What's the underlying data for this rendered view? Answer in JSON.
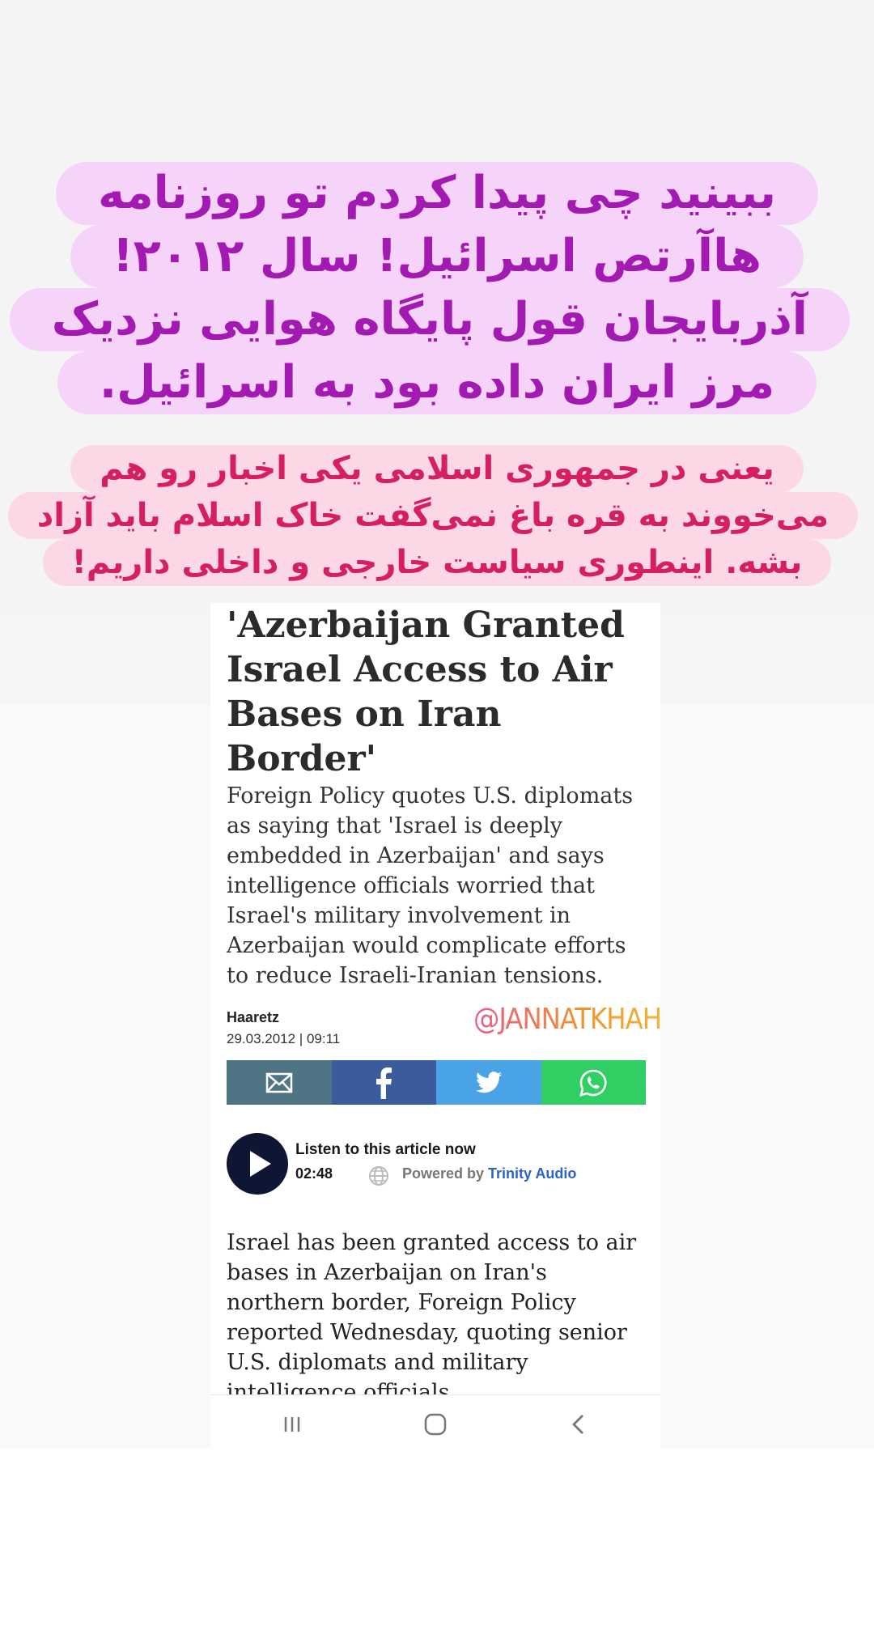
{
  "overlay": {
    "purple_lines": [
      "ببینید چی پیدا کردم تو روزنامه",
      "هاآرتص اسرائیل! سال ۲۰۱۲!",
      "آذربایجان قول پایگاه هوایی نزدیک",
      "مرز ایران داده بود به اسرائیل."
    ],
    "pink_lines": [
      "یعنی در جمهوری اسلامی یکی اخبار رو هم",
      "می‌خووند به قره باغ نمی‌گفت خاک اسلام باید آزاد",
      "بشه. اینطوری سیاست خارجی و داخلی داریم!"
    ],
    "purple_color": "#a31ab3",
    "pink_color": "#d61f63"
  },
  "article": {
    "headline": "'Azerbaijan Granted Israel Access to Air Bases on Iran Border'",
    "summary": "Foreign Policy quotes U.S. diplomats as saying that 'Israel is deeply embedded in Azerbaijan' and says intelligence officials worried that Israel's military involvement in Azerbaijan would complicate efforts to reduce Israeli-Iranian tensions.",
    "source": "Haaretz",
    "date": "29.03.2012 | 09:11",
    "watermark": "@JANNATKHAH.IR",
    "share": [
      {
        "name": "email-icon",
        "color": "#4f7584"
      },
      {
        "name": "facebook-icon",
        "color": "#3a5c9c"
      },
      {
        "name": "twitter-icon",
        "color": "#4aa3e6"
      },
      {
        "name": "whatsapp-icon",
        "color": "#2fcf63"
      }
    ],
    "audio": {
      "title": "Listen to this article now",
      "duration": "02:48",
      "powered_by": "Powered by",
      "provider": "Trinity Audio"
    },
    "body": "Israel has been granted access to air bases in Azerbaijan on Iran's northern border, Foreign Policy reported Wednesday, quoting senior U.S. diplomats and military intelligence officials."
  },
  "nav": {
    "items": [
      "recents-icon",
      "home-icon",
      "back-icon"
    ]
  }
}
